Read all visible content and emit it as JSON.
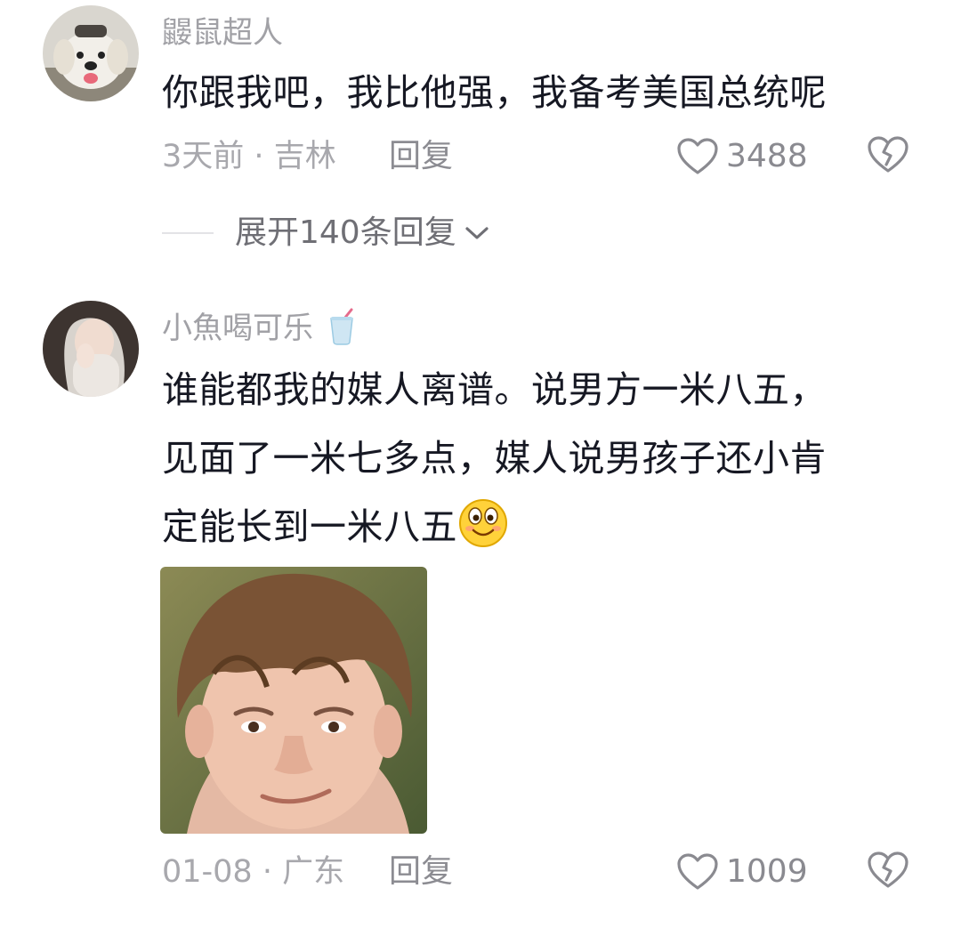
{
  "comments": [
    {
      "username": "鼹鼠超人",
      "content": "你跟我吧，我比他强，我备考美国总统呢",
      "time": "3天前",
      "location": "吉林",
      "reply_label": "回复",
      "likes": "3488",
      "avatar_icon": "puppy-avatar",
      "expand_label": "展开140条回复"
    },
    {
      "username": "小魚喝可乐",
      "username_icon": "cup-drink-icon",
      "content_lines": [
        "谁能都我的媒人离谱。说男方一米八五，",
        "见面了一米七多点，媒人说男孩子还小肯",
        "定能长到一米八五"
      ],
      "inline_emoji": "smiling-face-emoji",
      "image": "kid-smirk-meme-photo",
      "time": "01-08",
      "location": "广东",
      "reply_label": "回复",
      "likes": "1009",
      "avatar_icon": "girl-avatar"
    }
  ],
  "separator": "·",
  "colors": {
    "text_primary": "#161823",
    "text_secondary": "#a8a8ad",
    "action_text": "#8c8c92",
    "icon_gray": "#8a8a90"
  }
}
